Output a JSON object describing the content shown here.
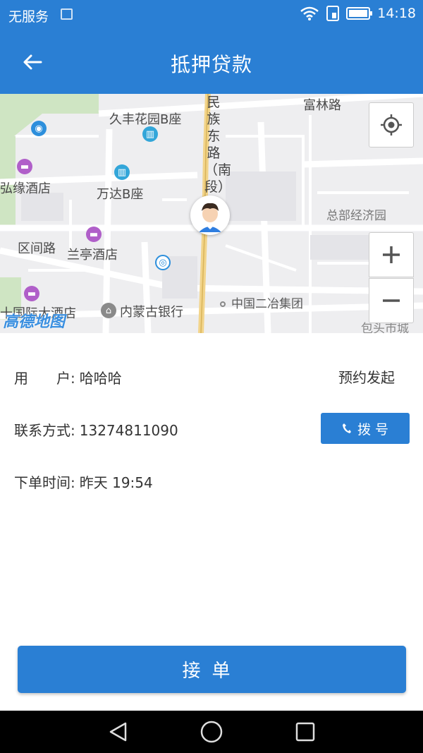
{
  "status_bar": {
    "carrier": "无服务",
    "time": "14:18",
    "icons": [
      "image-notification-icon",
      "wifi-icon",
      "sim-icon",
      "battery-icon"
    ]
  },
  "app_bar": {
    "title": "抵押贷款",
    "back_icon": "arrow-left-icon"
  },
  "map": {
    "labels": {
      "fulin_road": "富林路",
      "jiufeng": "久丰花园B座",
      "hongyuan": "弘缘酒店",
      "wanda": "万达B座",
      "zongbu": "总部经济园",
      "qujian": "区间路",
      "lanting": "兰亭酒店",
      "zhongguo_erye": "中国二冶集团",
      "neimenggu_bank": "内蒙古银行",
      "guoji_hotel": "十国际大酒店",
      "baotou_city": "包头市城",
      "road_vertical": "民族东路（南段）",
      "logo": "高德地图"
    },
    "controls": {
      "locate_icon": "crosshair-icon",
      "zoom_in": "+",
      "zoom_out": "−"
    }
  },
  "order": {
    "user_label": "用　　户:",
    "user_value": "哈哈哈",
    "status": "预约发起",
    "contact_label": "联系方式:",
    "contact_value": "13274811090",
    "dial_label": "拨 号",
    "time_label": "下单时间:",
    "time_value": "昨天 19:54"
  },
  "accept_button": {
    "label": "接单"
  },
  "colors": {
    "primary": "#2a7fd4",
    "map_bg": "#eeeef0",
    "nav_bar": "#000000"
  }
}
